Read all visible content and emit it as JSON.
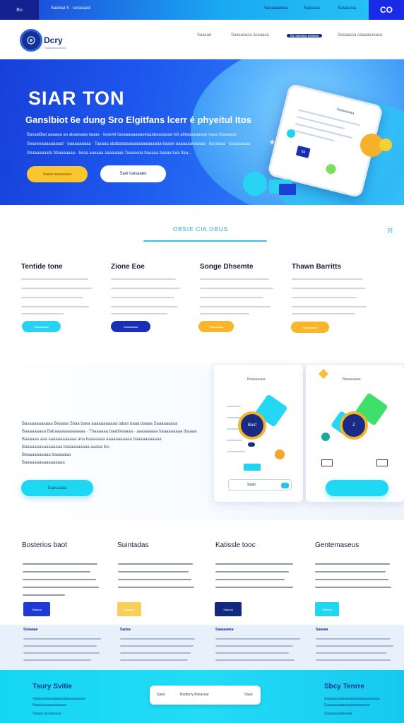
{
  "topbar": {
    "logo": "Bu",
    "promo": "Saeteat 5 · sorasaed",
    "links": [
      "Sasasaanaa",
      "Sasssas",
      "Sasasosa"
    ],
    "cta": "CO"
  },
  "nav": {
    "brand_name": "Dcry",
    "brand_tagline": "Saasssasaaasoa",
    "links": [
      "Saasae",
      "Saasasasa assaasa",
      "Sa sasaaa assaas",
      "Sasaassa caaaasasasa"
    ]
  },
  "hero": {
    "title": "SIAR TON",
    "subtitle": "Ganslbiot 6e dung Sro Elgitfans lcerr é phyeitul Itos",
    "lines": [
      "Basaalibat aaaaaa ao abaasaaa taaaa · beaoet taoaaaaaaaaoeaaabaasaaaa leit abtaaaaaaaae baaa ittaaaaaa",
      "Seaseeaaaaaaaaat · baaaaaaaaa · Taaaaa ababaaaaaaaaaaaaaaaaaa baaoe aaaaaaataeaaa · basaaaa · baaaaaaaa",
      "Sbaaaaaaata Sbaaaaaaa · beaa aaaaaa aaaaaaaa Taaeeeaa baaaaa  baaaa baa Itaa..."
    ],
    "primary_button": "Saaaa aaaaaaaaa",
    "secondary_button": "Saoi tsesaaeo",
    "tablet": {
      "title": "Saaaaaaaa",
      "chip": "Sa"
    }
  },
  "features": {
    "heading": "OBSIE CI6.OBUS",
    "side_mark": "R",
    "cards": [
      {
        "title": "Tentide tone",
        "button": "Saasaaaaa",
        "color": "#27d3f2"
      },
      {
        "title": "Zione Eoe",
        "button": "Saasaaaaa",
        "color": "#1a2fb8"
      },
      {
        "title": "Songe Dhsemte",
        "button": "Saasaaaaa",
        "color": "#f9b62a"
      },
      {
        "title": "Thawn Barritts",
        "button": "Saasaaaaa",
        "color": "#f9b62a"
      }
    ]
  },
  "showcase": {
    "lines": [
      "Basaaaaaaaaaa Beaaaa Sbaa baea aaaaaaaaaaa tabas baaa baaaa Saaaaaaasa",
      "Baaaaaaaaa Babaaaaaaaaaaaaa · Tbaaaaaa baabbeaaaa · aaaaaaaaa baaaaaaaaa Ibaaaa",
      "Baaaaaa aaa aaaaaaaaaaaa ana baaaaaaa aaaaaaaaaaa baaaaaaaaaaa",
      "Baaaaaaaaaaaaaaaa baaaaaaaaaa aaaaa ibo",
      "Beaaaaaaaaaa baaaaaaa",
      "Baaaaaaaaaaaaaaaaa"
    ],
    "button": "Saasaaaa",
    "panel_left": {
      "title": "Baaaaaaaa",
      "gem": "Bosf",
      "input_value": "Saab"
    },
    "panel_right": {
      "title": "Baaaaaaaa",
      "gem": "Z"
    }
  },
  "columns": {
    "titles": [
      "Bosterios baot",
      "Suintadas",
      "Katissle tooc",
      "Gentemaseus"
    ],
    "buttons": [
      {
        "label": "Saasoa",
        "color": "#1f3ad6"
      },
      {
        "label": "Saasoa",
        "color": "#f7cf5a"
      },
      {
        "label": "Saasoa",
        "color": "#122a7e"
      },
      {
        "label": "Saasoa",
        "color": "#21d6f1"
      }
    ],
    "strip_heads": [
      "Sosaaaa",
      "Saosa",
      "Saaaaaasa",
      "Saasaa"
    ]
  },
  "footer": {
    "left_title": "Tsury Svitie",
    "left_lines": [
      "Saaaasaaaaaaaaaaaaaasaaaaaa",
      "Baaaaaaaaaaaaaaaa",
      "Saaaa aaaaaaaaa"
    ],
    "form": {
      "left": "Saao",
      "center": "Badterry Bssasiae",
      "right": "Saao"
    },
    "right_title": "Sbcy Tenrre",
    "right_lines": [
      "Saaaaaaaaaaaaaaaaaaaaaaaaaaa",
      "Saaaaaaaaaaaaaaaaaaaaaa",
      "Saaaaaaaaaaaaa"
    ]
  }
}
